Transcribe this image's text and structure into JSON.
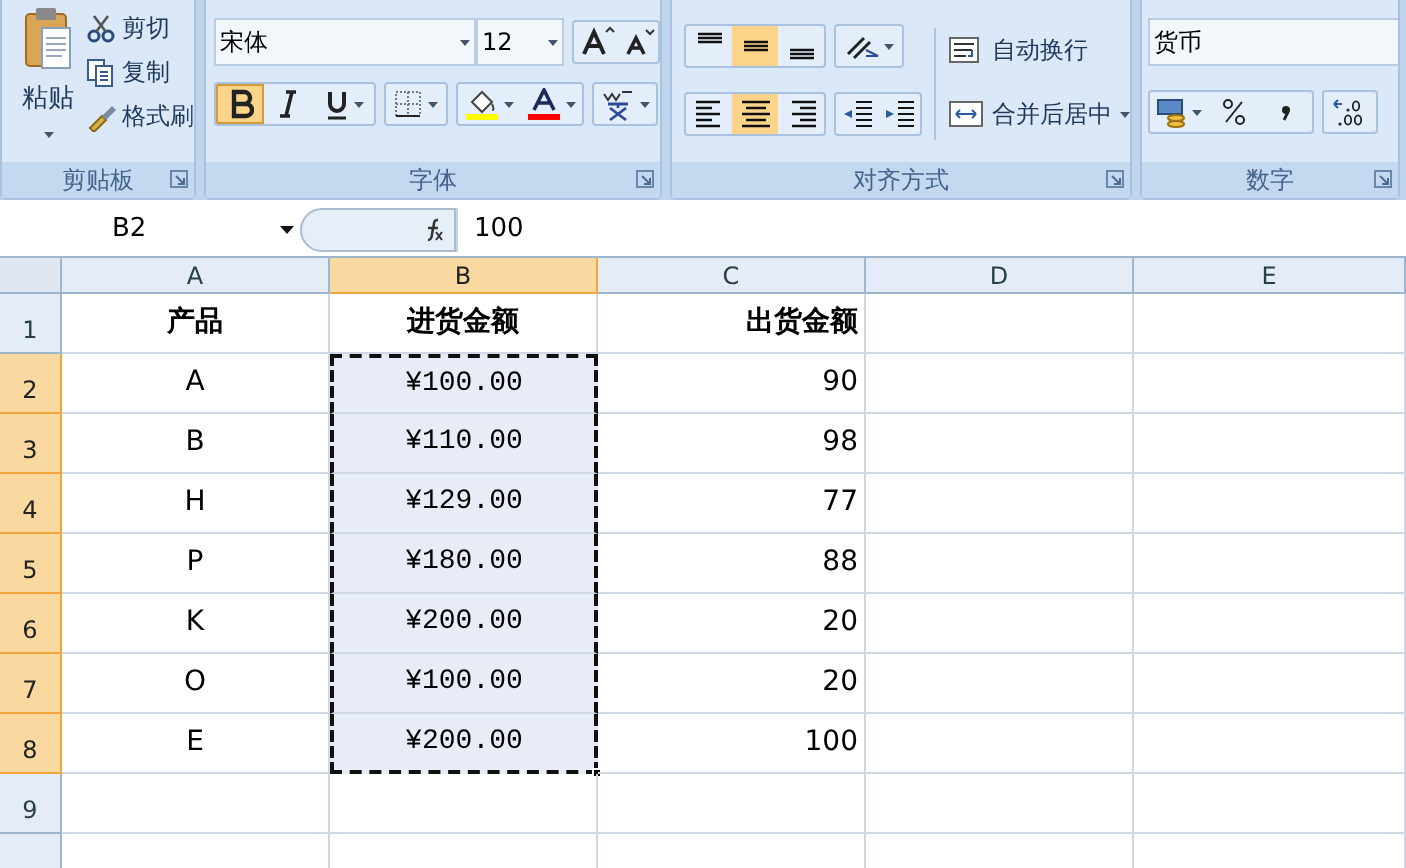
{
  "ribbon": {
    "clipboard": {
      "paste": "粘贴",
      "actions": [
        {
          "kind": "cut",
          "label": "剪切"
        },
        {
          "kind": "copy",
          "label": "复制"
        },
        {
          "kind": "painter",
          "label": "格式刷"
        }
      ],
      "label": "剪贴板"
    },
    "font": {
      "font_name": "宋体",
      "font_size": "12",
      "styles": [
        {
          "kind": "bold",
          "selected": true
        },
        {
          "kind": "italic",
          "selected": false
        },
        {
          "kind": "underline",
          "selected": false
        }
      ],
      "label": "字体"
    },
    "alignment": {
      "vertical": [
        {
          "kind": "top",
          "selected": false
        },
        {
          "kind": "middle",
          "selected": true
        },
        {
          "kind": "bottom",
          "selected": false
        }
      ],
      "horizontal": [
        {
          "kind": "left",
          "selected": false
        },
        {
          "kind": "center",
          "selected": true
        },
        {
          "kind": "right",
          "selected": false
        }
      ],
      "wrap": "自动换行",
      "merge": "合并后居中",
      "label": "对齐方式"
    },
    "number": {
      "format": "货币",
      "label": "数字"
    }
  },
  "formula_bar": {
    "name_box": "B2",
    "formula": "100"
  },
  "sheet": {
    "columns": [
      {
        "label": "A",
        "selected": false
      },
      {
        "label": "B",
        "selected": true
      },
      {
        "label": "C",
        "selected": false
      },
      {
        "label": "D",
        "selected": false
      },
      {
        "label": "E",
        "selected": false
      }
    ],
    "rows": [
      {
        "label": "1",
        "kind": "header",
        "selected": false,
        "cells": [
          "产品",
          "进货金额",
          "出货金额"
        ]
      },
      {
        "label": "2",
        "kind": "data",
        "selected": true,
        "cells": [
          "A",
          "¥100.00",
          "90"
        ]
      },
      {
        "label": "3",
        "kind": "data",
        "selected": true,
        "cells": [
          "B",
          "¥110.00",
          "98"
        ]
      },
      {
        "label": "4",
        "kind": "data",
        "selected": true,
        "cells": [
          "H",
          "¥129.00",
          "77"
        ]
      },
      {
        "label": "5",
        "kind": "data",
        "selected": true,
        "cells": [
          "P",
          "¥180.00",
          "88"
        ]
      },
      {
        "label": "6",
        "kind": "data",
        "selected": true,
        "cells": [
          "K",
          "¥200.00",
          "20"
        ]
      },
      {
        "label": "7",
        "kind": "data",
        "selected": true,
        "cells": [
          "O",
          "¥100.00",
          "20"
        ]
      },
      {
        "label": "8",
        "kind": "data",
        "selected": true,
        "cells": [
          "E",
          "¥200.00",
          "100"
        ]
      },
      {
        "label": "9",
        "kind": "data",
        "selected": false
      }
    ]
  }
}
